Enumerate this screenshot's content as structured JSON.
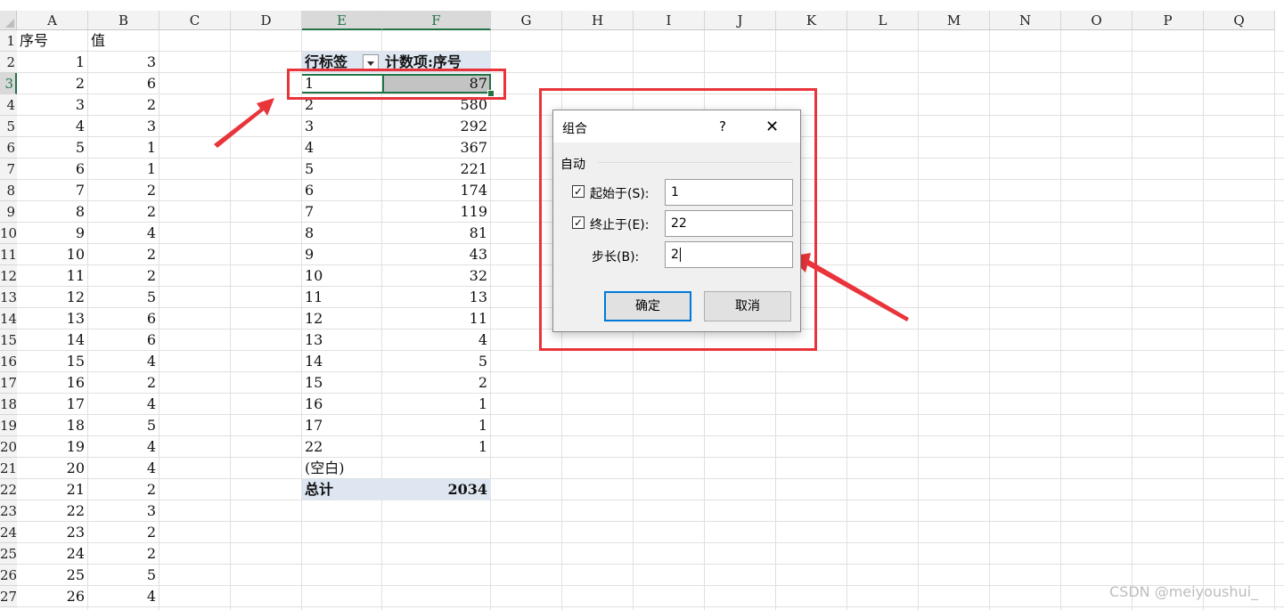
{
  "columns": [
    "A",
    "B",
    "C",
    "D",
    "E",
    "F",
    "G",
    "H",
    "I",
    "J",
    "K",
    "L",
    "M",
    "N",
    "O",
    "P",
    "Q"
  ],
  "rows": [
    "1",
    "2",
    "3",
    "4",
    "5",
    "6",
    "7",
    "8",
    "9",
    "10",
    "11",
    "12",
    "13",
    "14",
    "15",
    "16",
    "17",
    "18",
    "19",
    "20",
    "21",
    "22",
    "23",
    "24",
    "25",
    "26",
    "27"
  ],
  "sheet_a": {
    "header_seq": "序号",
    "header_val": "值",
    "seq": [
      "1",
      "2",
      "3",
      "4",
      "5",
      "6",
      "7",
      "8",
      "9",
      "10",
      "11",
      "12",
      "13",
      "14",
      "15",
      "16",
      "17",
      "18",
      "19",
      "20",
      "21",
      "22",
      "23",
      "24",
      "25",
      "26"
    ],
    "val": [
      "3",
      "6",
      "2",
      "3",
      "1",
      "1",
      "2",
      "2",
      "4",
      "2",
      "2",
      "5",
      "6",
      "6",
      "4",
      "2",
      "4",
      "5",
      "4",
      "4",
      "2",
      "3",
      "2",
      "2",
      "5",
      "4"
    ]
  },
  "pivot": {
    "row_label_header": "行标签",
    "count_header": "计数项:序号",
    "labels": [
      "1",
      "2",
      "3",
      "4",
      "5",
      "6",
      "7",
      "8",
      "9",
      "10",
      "11",
      "12",
      "13",
      "14",
      "15",
      "16",
      "17",
      "22",
      "(空白)"
    ],
    "counts": [
      "87",
      "580",
      "292",
      "367",
      "221",
      "174",
      "119",
      "81",
      "43",
      "32",
      "13",
      "11",
      "4",
      "5",
      "2",
      "1",
      "1",
      "1",
      ""
    ],
    "total_label": "总计",
    "total_value": "2034"
  },
  "dialog": {
    "title": "组合",
    "help": "?",
    "close": "✕",
    "group_label": "自动",
    "start_label": "起始于(S):",
    "start_value": "1",
    "start_checked": true,
    "end_label": "终止于(E):",
    "end_value": "22",
    "end_checked": true,
    "step_label": "步长(B):",
    "step_value": "2",
    "ok": "确定",
    "cancel": "取消"
  },
  "watermark": "CSDN @meiyoushui_",
  "colors": {
    "highlight": "#e8343a",
    "excel_green": "#217346",
    "pivot_header": "#dde6f1"
  }
}
